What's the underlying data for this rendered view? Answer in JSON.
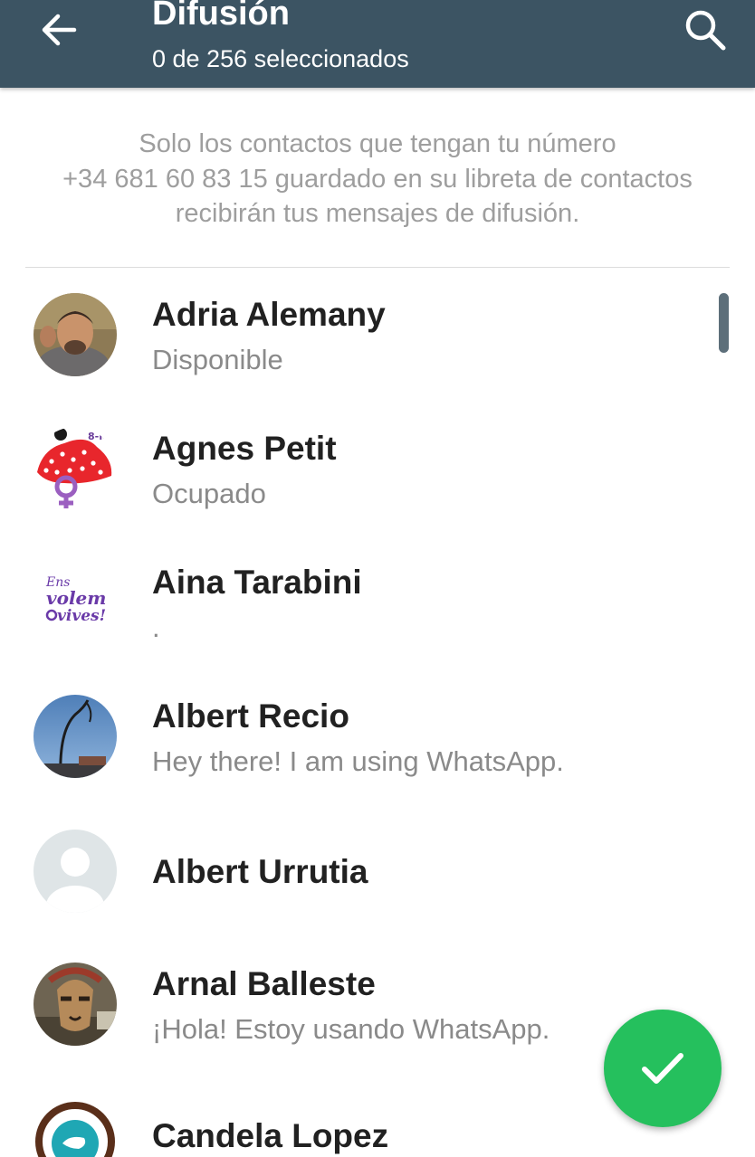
{
  "header": {
    "title": "Difusión",
    "subtitle": "0 de 256 seleccionados",
    "background_color": "#3c5463",
    "back_icon": "arrow-left-icon",
    "search_icon": "search-icon"
  },
  "notice": {
    "lines": [
      "Solo los contactos que tengan tu número",
      "+34 681 60 83 15 guardado en su libreta de contactos",
      "recibirán tus mensajes de difusión."
    ]
  },
  "contacts": [
    {
      "name": "Adria Alemany",
      "status": "Disponible"
    },
    {
      "name": "Agnes Petit",
      "status": "Ocupado"
    },
    {
      "name": "Aina Tarabini",
      "status": "."
    },
    {
      "name": "Albert Recio",
      "status": "Hey there! I am using WhatsApp."
    },
    {
      "name": "Albert Urrutia",
      "status": ""
    },
    {
      "name": "Arnal Balleste",
      "status": "¡Hola! Estoy usando WhatsApp."
    },
    {
      "name": "Candela Lopez",
      "status": ""
    }
  ],
  "avatar_texts": {
    "aina": {
      "line1": "Ens",
      "line2": "volem",
      "line3": "vives!"
    },
    "agnes": {
      "tag": "8-M"
    }
  },
  "fab": {
    "icon": "check-icon",
    "color": "#25c05d"
  }
}
